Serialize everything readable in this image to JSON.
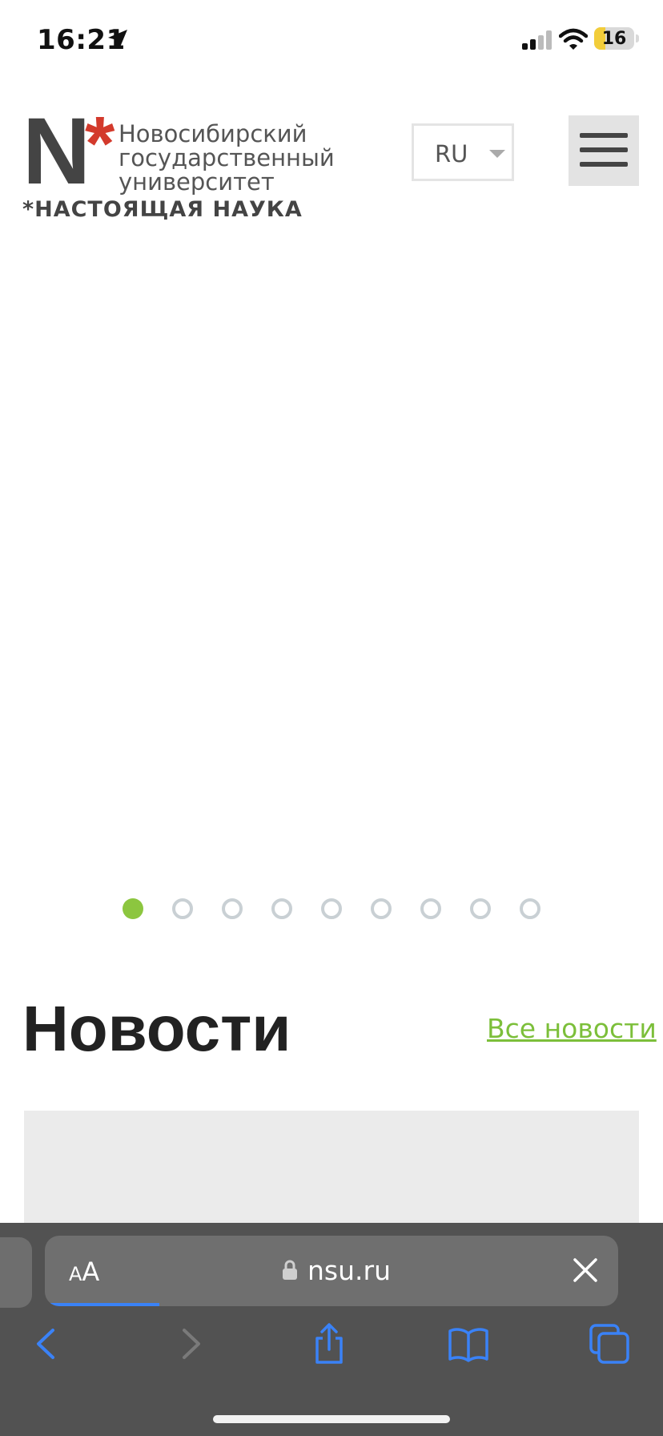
{
  "status_bar": {
    "time": "16:21",
    "battery_level": "16",
    "icons": [
      "location-arrow-icon",
      "cellular-signal-icon",
      "wifi-icon",
      "battery-icon"
    ]
  },
  "header": {
    "logo": {
      "letter": "N",
      "asterisk": "*",
      "lines": [
        "Новосибирский",
        "государственный",
        "университет"
      ],
      "slogan": "*НАСТОЯЩАЯ НАУКА"
    },
    "language": {
      "selected": "RU"
    },
    "menu_icon": "hamburger-menu-icon"
  },
  "slider": {
    "dot_count": 9,
    "active_index": 0
  },
  "news": {
    "title": "Новости",
    "all_link": "Все новости"
  },
  "browser": {
    "text_size_label_small": "A",
    "text_size_label_big": "A",
    "url": "nsu.ru",
    "load_progress": 0.2,
    "toolbar_icons": [
      "back-icon",
      "forward-icon",
      "share-icon",
      "bookmarks-icon",
      "tabs-icon"
    ]
  },
  "colors": {
    "accent_green": "#8cc63f",
    "link_green": "#7cbf3a",
    "logo_red": "#d33a2c",
    "browser_chrome": "#525252",
    "ios_blue": "#3a82f7"
  }
}
